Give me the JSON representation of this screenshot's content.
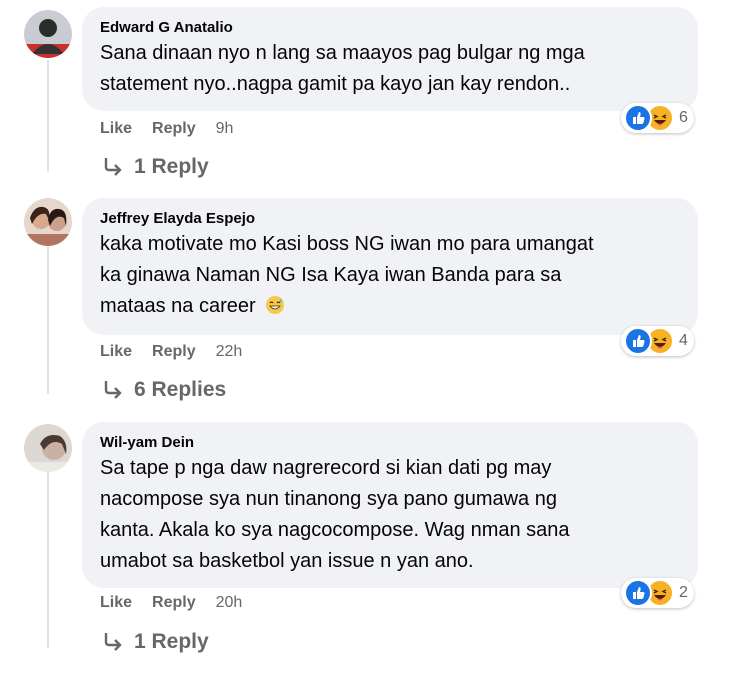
{
  "comments": [
    {
      "author": "Edward G Anatalio",
      "lines": [
        "Sana dinaan nyo n lang sa maayos pag bulgar ng mga",
        "statement nyo..nagpa gamit pa kayo jan kay rendon.."
      ],
      "like_label": "Like",
      "reply_label": "Reply",
      "time": "9h",
      "reaction_count": "6",
      "replies_label": "1 Reply"
    },
    {
      "author": "Jeffrey Elayda Espejo",
      "lines": [
        "kaka motivate mo Kasi boss NG iwan mo para umangat",
        "ka ginawa Naman NG Isa Kaya iwan Banda para sa",
        "mataas na career"
      ],
      "emoji": "grinning-sweat-emoji",
      "like_label": "Like",
      "reply_label": "Reply",
      "time": "22h",
      "reaction_count": "4",
      "replies_label": "6 Replies"
    },
    {
      "author": "Wil-yam Dein",
      "lines": [
        "Sa tape p nga daw nagrerecord si kian dati pg may",
        "nacompose sya nun tinanong sya pano gumawa ng",
        "kanta. Akala ko sya nagcocompose. Wag nman sana",
        "umabot sa basketbol yan issue n yan ano."
      ],
      "like_label": "Like",
      "reply_label": "Reply",
      "time": "20h",
      "reaction_count": "2",
      "replies_label": "1 Reply"
    }
  ],
  "reaction_icons": [
    "like-icon",
    "haha-icon"
  ],
  "colors": {
    "bubble": "#f0f2f5",
    "secondary_text": "#65676b",
    "like_blue": "#1b74e4",
    "haha_yellow": "#f7b125"
  }
}
